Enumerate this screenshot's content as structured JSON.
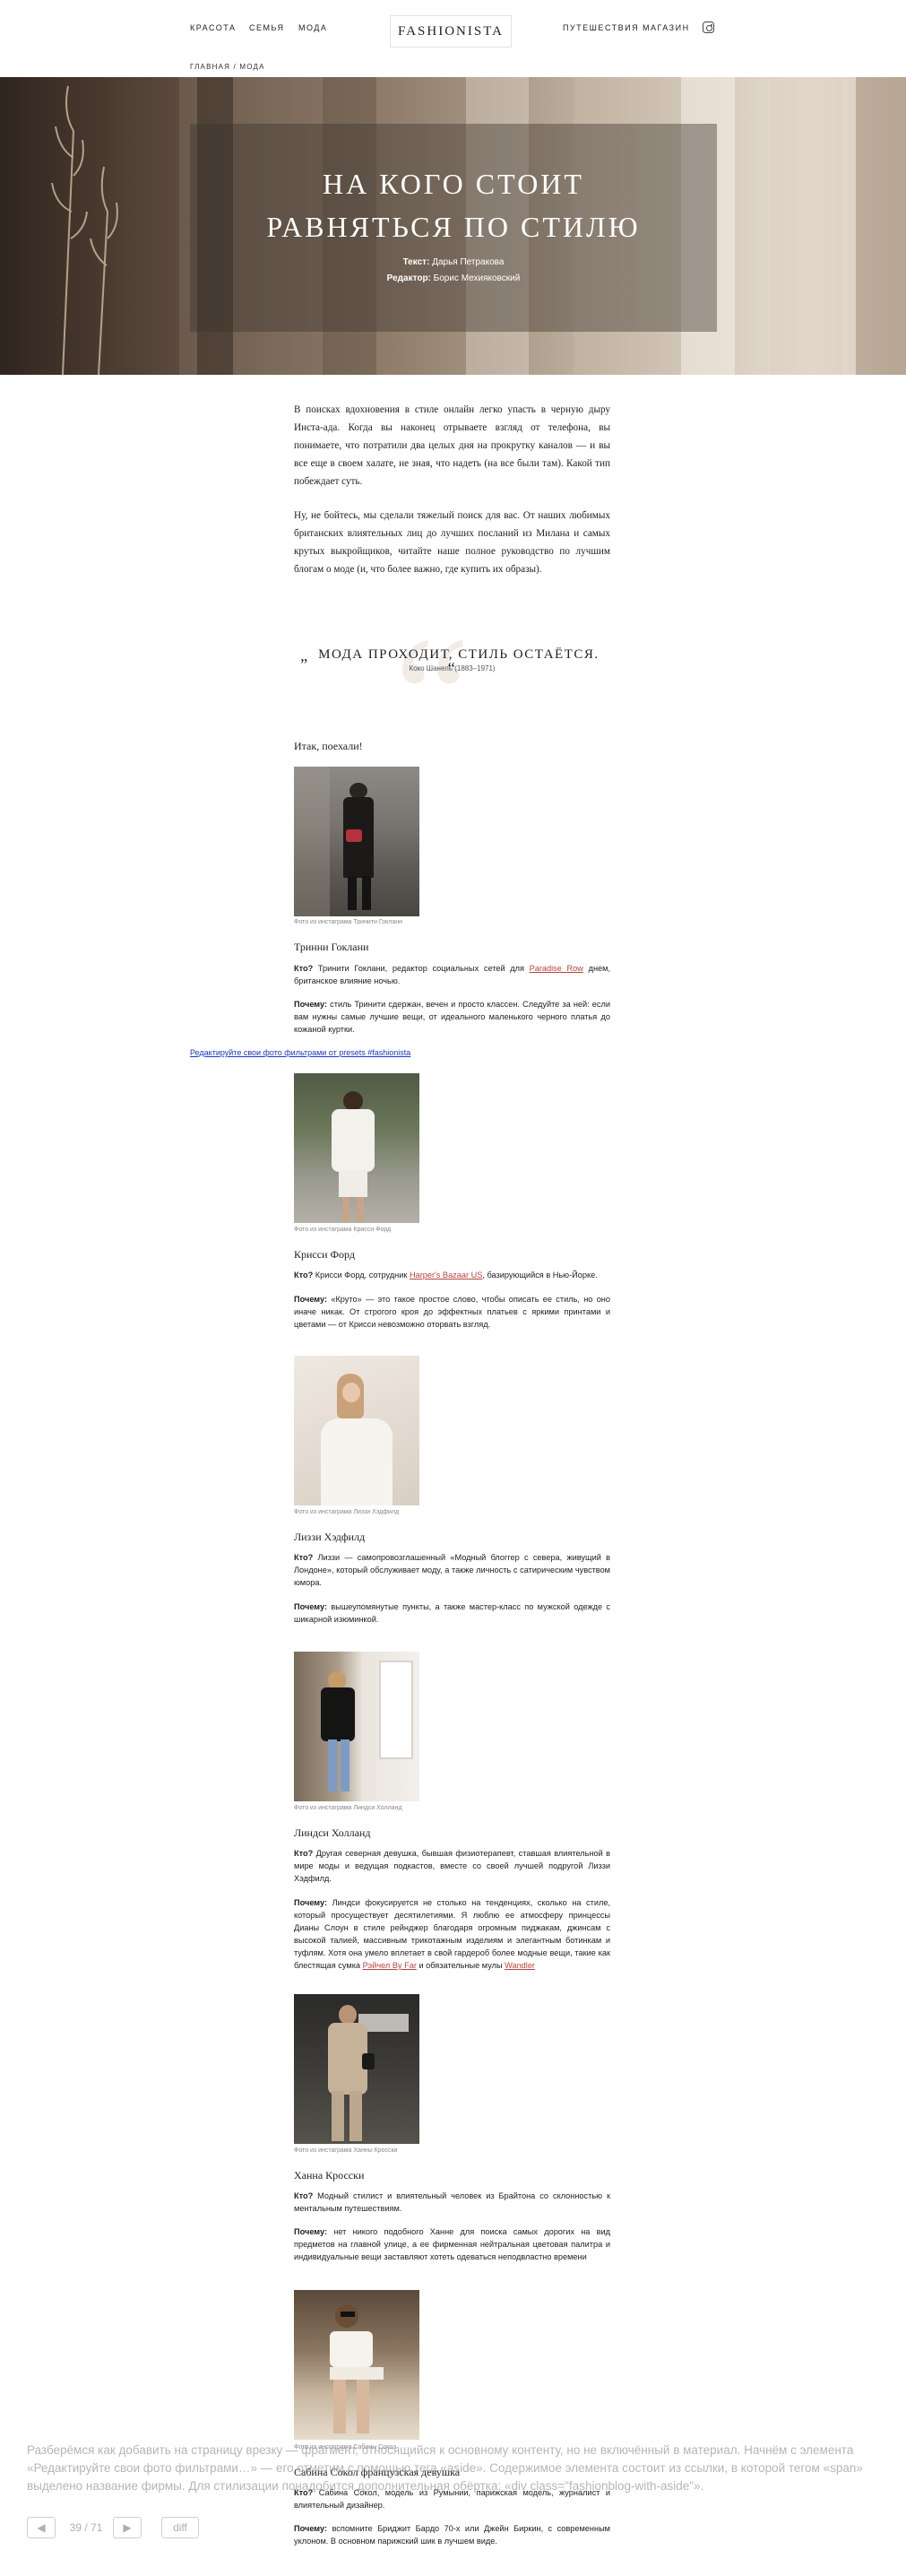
{
  "nav": {
    "left": [
      "КРАСОТА",
      "СЕМЬЯ",
      "МОДА"
    ],
    "logo": "FASHIONISTA",
    "right": [
      "ПУТЕШЕСТВИЯ",
      "МАГАЗИН"
    ],
    "breadcrumb": "ГЛАВНАЯ / МОДА"
  },
  "hero": {
    "title_line1": "НА КОГО СТОИТ",
    "title_line2": "РАВНЯТЬСЯ ПО СТИЛЮ",
    "author_label": "Текст:",
    "author": "Дарья Петракова",
    "editor_label": "Редактор:",
    "editor": "Борис Мехияковский"
  },
  "intro": {
    "p1": "В поисках вдохновения в стиле онлайн легко упасть в черную дыру Инста-ада. Когда вы наконец отрывaете взгляд от телефона, вы понимаете, что потратили два целых дня на прокрутку каналов — и вы все еще в своем халате, не зная, что надеть (на все были там). Какой тип побеждает суть.",
    "p2": "Ну, не бойтесь, мы сделали тяжелый поиск для вас. От наших любимых британских влиятельных лиц до лучших посланий из Милана и самых крутых выкройщиков, читайте наше полное руководство по лучшим блогам о моде (и, что более важно, где купить их образы)."
  },
  "quote": {
    "open": "„",
    "text": "МОДА ПРОХОДИТ, СТИЛЬ ОСТАЁТСЯ.",
    "close": "“",
    "author": "Коко Шанель (1883–1971)"
  },
  "lead": "Итак, поехали!",
  "embed_link": "Редактируйте свои фото фильтрами от presets #fashionista",
  "bloggers": [
    {
      "caption": "Фото из инстаграма Тринити Гоклани",
      "name": "Тринни Гоклани",
      "who_label": "Кто?",
      "who": " Тринити Гоклани, редактор социальных сетей для ",
      "who_link": "Paradise Row",
      "who_end": " днем, британское влияние ночью.",
      "why_label": "Почему:",
      "why": " стиль Тринити сдержан, вечен и просто классен. Следуйте за ней: если вам нужны самые лучшие вещи, от идеального маленького черного платья до кожаной куртки."
    },
    {
      "caption": "Фото из инстаграма Крисси Форд",
      "name": "Крисси Форд",
      "who_label": "Кто?",
      "who": " Крисси Форд, сотрудник ",
      "who_link": "Harper's Bazaar US",
      "who_end": ", базирующийся в Нью-Йорке.",
      "why_label": "Почему:",
      "why": " «Круто» — это такое простое слово, чтобы описать ее стиль, но оно иначе никак. От строгого кроя до эффектных платьев с яркими принтами и цветами — от Крисси невозможно оторвать взгляд."
    },
    {
      "caption": "Фото из инстаграма Лиззи Хэдфилд",
      "name": "Лиззи Хэдфилд",
      "who_label": "Кто?",
      "who": " Лиззи — самопровозглашенный «Модный блоггер с севера, живущий в Лондоне», который обслуживает моду, а также личность с сатирическим чувством юмора.",
      "why_label": "Почему:",
      "why": " вышеупомянутые пункты, а также мастер-класс по мужской одежде с шикарной изюминкой."
    },
    {
      "caption": "Фото из инстаграма Линдси Холланд",
      "name": "Линдси Холланд",
      "who_label": "Кто?",
      "who": " Другая северная девушка, бывшая физиотерапевт, ставшая влиятельной в мире моды и ведущая подкастов, вместе со своей лучшей подругой Лиззи Хэдфилд.",
      "why_label": "Почему:",
      "why": " Линдси фокусируется не столько на тенденциях, сколько на стиле, который просуществует десятилетиями. Я люблю ее атмосферу принцессы Дианы Слоун в стиле рейнджер благодаря огромным пиджакам, джинсам с высокой талией, массивным трикотажным изделиям и элегантным ботинкам и туфлям. Хотя она умело вплетает в свой гардероб более модные вещи, такие как блестящая сумка ",
      "why_link": "Рэйчел By Far",
      "why_mid": " и обязательные мулы ",
      "why_link2": "Wandler"
    },
    {
      "caption": "Фото из инстаграма Ханны Кросски",
      "name": "Ханна Кросски",
      "who_label": "Кто?",
      "who": " Модный стилист и влиятельный человек из Брайтона со склонностью к ментальным путешествиям.",
      "why_label": "Почему:",
      "why": " нет никого подобного Ханне для поиска самых дорогих на вид предметов на главной улице, а ее фирменная нейтральная цветовая палитра и индивидуальные вещи заставляют хотеть одеваться неподвластно времени"
    },
    {
      "caption": "Фото из инстаграма Сабины Сокол",
      "name": "Сабина Сокол французская девушка",
      "who_label": "Кто?",
      "who": " Сабина Сокол, модель из Румынии, парижская модель, журналист и влиятельный дизайнер.",
      "why_label": "Почему:",
      "why": " вспомните Бриджит Бардо 70-х или Джейн Биркин, с современным уклоном. В основном парижский шик в лучшем виде."
    }
  ],
  "overlay": {
    "text": "Разберёмся как добавить на страницу врезку — фрагмент, относящийся к основному контенту, но не включённый в материал. Начнём с элемента «Редактируйте свои фото фильтрами…» — его отметим с помощью тега «aside». Содержимое элемента состоит из ссылки, в которой тегом «span» выделено название фирмы. Для стилизации понадобится дополнительная обёртка: «div class=\"fashionblog-with-aside\"».",
    "counter": "39 / 71",
    "prev": "◀",
    "next": "▶",
    "diff": "diff"
  }
}
